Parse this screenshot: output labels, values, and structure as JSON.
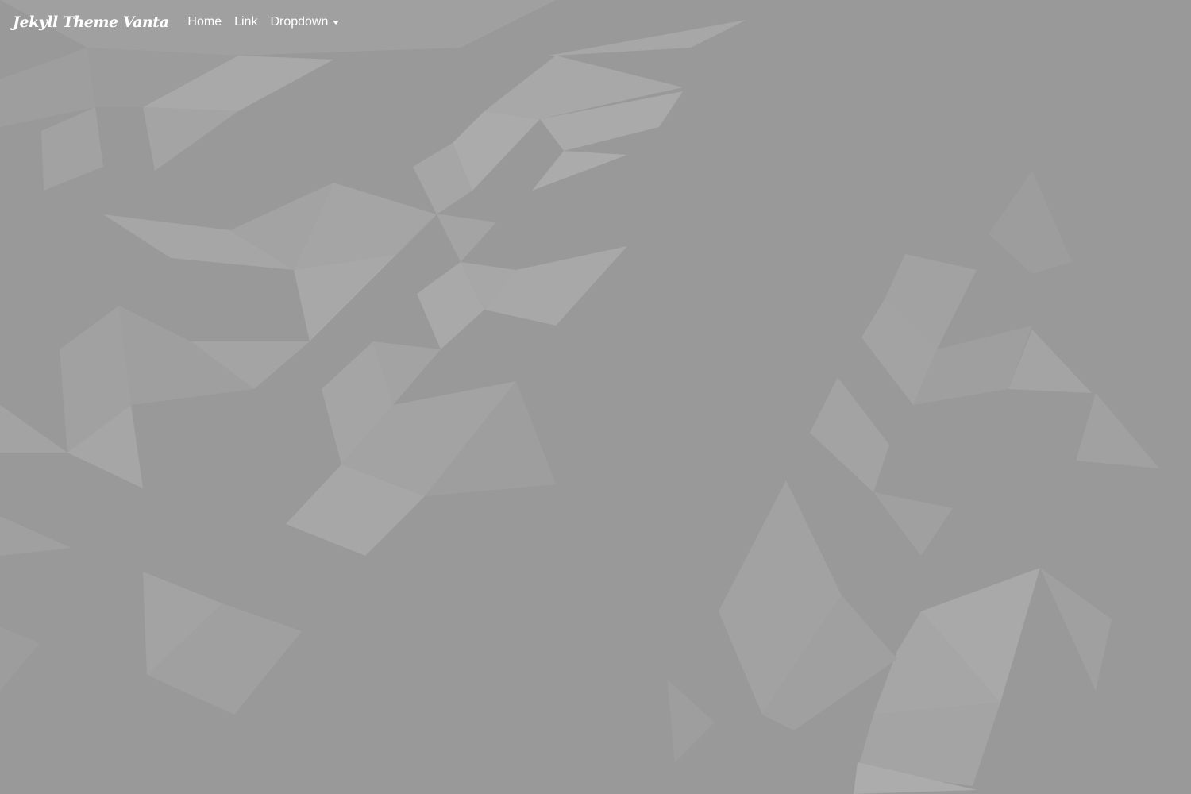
{
  "navbar": {
    "brand": "Jekyll Theme Vanta",
    "links": [
      {
        "label": "Home"
      },
      {
        "label": "Link"
      },
      {
        "label": "Dropdown",
        "icon": "caret-down-icon"
      }
    ]
  },
  "colors": {
    "background": "#999999",
    "text": "#ffffff"
  }
}
